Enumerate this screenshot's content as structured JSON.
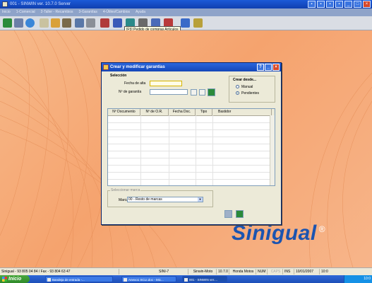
{
  "app": {
    "title": "001 - SINWIN ver. 10.7.0 Server",
    "menu": [
      "Inicio",
      "1-Comercial",
      "2-Taller - Recambios",
      "3-Garantías",
      "4-Útiles/Cambios",
      "Ayuda"
    ]
  },
  "toolbar": {
    "tooltip": "[F5] Pedido de compras Artículos",
    "icons": [
      "users-icon",
      "print-icon",
      "refresh-icon",
      "notes-icon",
      "gift-icon",
      "parts-icon",
      "scan-icon",
      "tools-icon",
      "invoice-icon",
      "stats-icon",
      "truck-icon",
      "calculator-icon",
      "folder-icon",
      "motorbike-icon",
      "chart-icon",
      "edit-icon"
    ]
  },
  "dialog": {
    "title": "Crear y modificar garantías",
    "section_label": "Selección",
    "fecha_alta_label": "Fecha de alta",
    "num_garantia_label": "Nº de garantía",
    "crear_desde_label": "Crear desde...",
    "radio_manual": "Manual",
    "radio_pendientes": "Pendientes",
    "columns": [
      "Nº Documento",
      "Nº de O.R.",
      "Fecha Doc.",
      "Tipo",
      "Bastidor"
    ],
    "seleccion_marca_label": "Seleccionar marca",
    "marca_label": "Marca",
    "marca_value": "00 - Resto de marcas"
  },
  "brand": {
    "name": "Sinigual",
    "mark": "®"
  },
  "statusbar": {
    "contact": "Sinigual - 93 805 04 84 / Fax - 93 804 63 47",
    "machine": "SINI-7",
    "server": "Sinwin-Moto",
    "version": "10.7.0",
    "dealer": "Honda Motos",
    "num": "NUM",
    "caps": "CAPS",
    "ins": "INS",
    "date": "10/01/2007",
    "time": "10:0"
  },
  "taskbar": {
    "start_label": "Inicio",
    "tasks": [
      "Bandeja de entrada -...",
      "Anexo1 SCLI.doc - Mic...",
      "001 - SINWIN ver...."
    ],
    "clock": "10:0"
  }
}
